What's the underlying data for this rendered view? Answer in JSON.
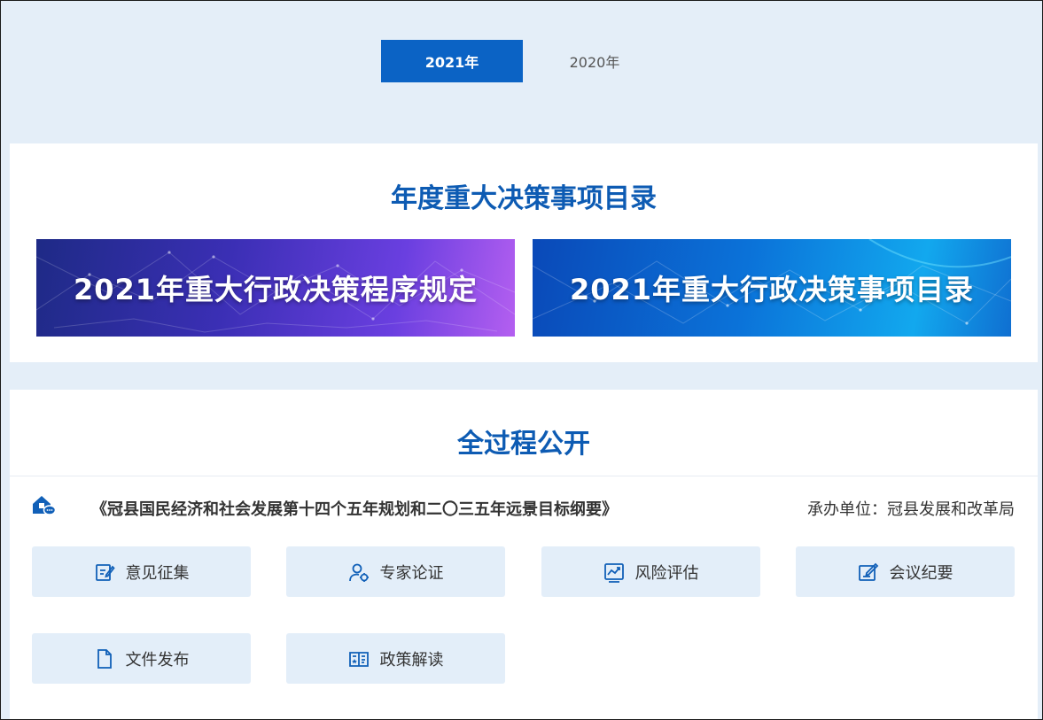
{
  "tabs": {
    "active": "2021年",
    "inactive": "2020年"
  },
  "catalog_section": {
    "title": "年度重大决策事项目录",
    "banners": [
      {
        "label": "2021年重大行政决策程序规定"
      },
      {
        "label": "2021年重大行政决策事项目录"
      }
    ]
  },
  "process_section": {
    "title": "全过程公开",
    "item": {
      "icon": "house-chat-icon",
      "title": "《冠县国民经济和社会发展第十四个五年规划和二〇三五年远景目标纲要》",
      "organizer": "承办单位：冠县发展和改革局"
    },
    "buttons": [
      {
        "label": "意见征集",
        "icon": "edit-note-icon"
      },
      {
        "label": "专家论证",
        "icon": "expert-user-icon"
      },
      {
        "label": "风险评估",
        "icon": "risk-chart-icon"
      },
      {
        "label": "会议纪要",
        "icon": "meeting-edit-icon"
      },
      {
        "label": "文件发布",
        "icon": "document-icon"
      },
      {
        "label": "政策解读",
        "icon": "policy-book-icon"
      }
    ]
  },
  "colors": {
    "accent": "#0b63c5",
    "title": "#0d5bb3",
    "background": "#e4eef8",
    "button_bg": "#e3eef9"
  }
}
